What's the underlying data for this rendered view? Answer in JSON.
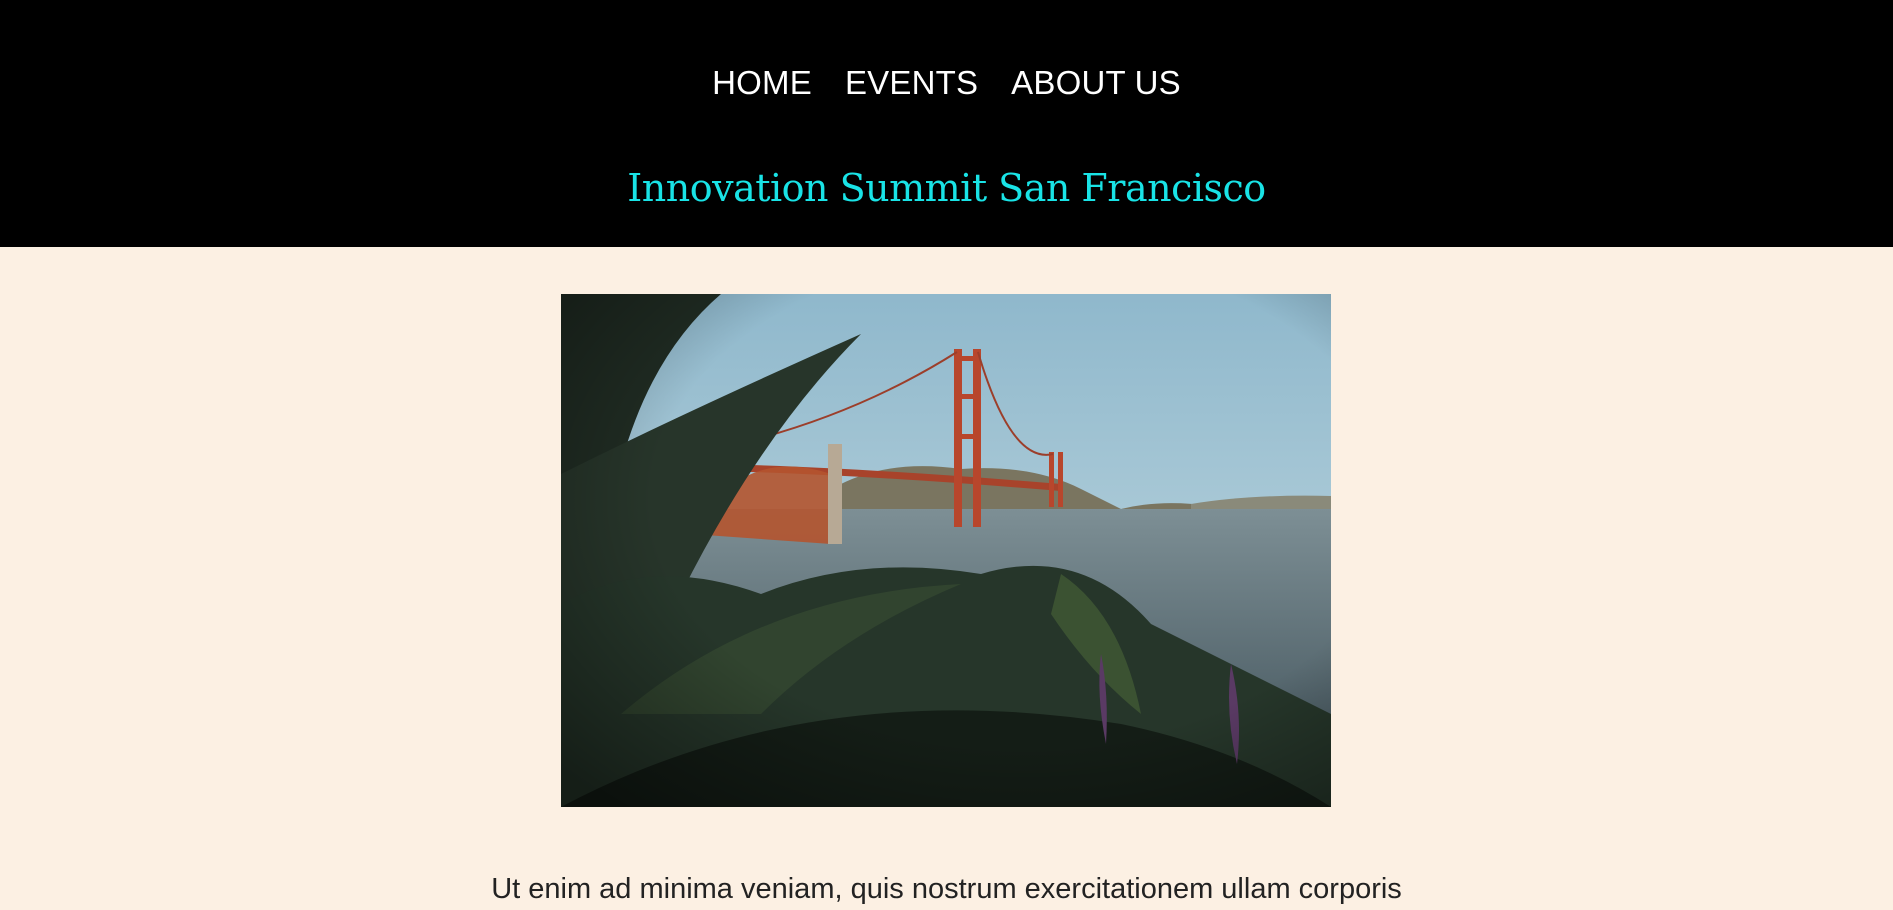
{
  "nav": {
    "home": "HOME",
    "events": "EVENTS",
    "about": "ABOUT US"
  },
  "header": {
    "title": "Innovation Summit San Francisco"
  },
  "hero": {
    "alt": "Golden Gate Bridge viewed through foliage"
  },
  "content": {
    "intro": "Ut enim ad minima veniam, quis nostrum exercitationem ullam corporis"
  },
  "colors": {
    "header_bg": "#000000",
    "page_bg": "#fcf0e3",
    "title_accent": "#19e3e6",
    "nav_text": "#ffffff",
    "body_text": "#222222"
  }
}
